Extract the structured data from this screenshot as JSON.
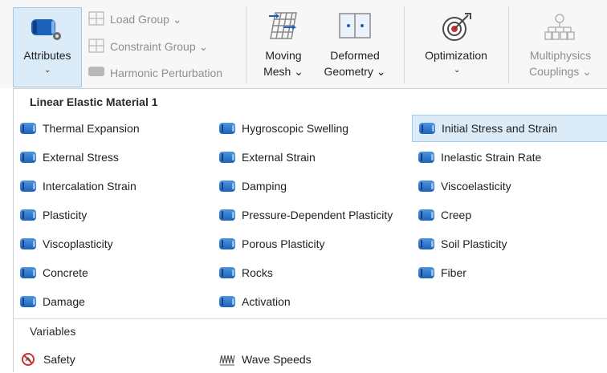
{
  "ribbon": {
    "attributes": {
      "label": "Attributes",
      "chevron": "⌄"
    },
    "load_group": "Load Group ⌄",
    "constraint_group": "Constraint Group ⌄",
    "harmonic_perturbation": "Harmonic Perturbation",
    "moving_mesh": {
      "line1": "Moving",
      "line2": "Mesh ⌄"
    },
    "deformed_geometry": {
      "line1": "Deformed",
      "line2": "Geometry ⌄"
    },
    "optimization": {
      "label": "Optimization",
      "chevron": "⌄"
    },
    "multiphysics": {
      "line1": "Multiphysics",
      "line2": "Couplings ⌄"
    }
  },
  "menu": {
    "section1_title": "Linear Elastic Material 1",
    "columns": [
      [
        "Thermal Expansion",
        "External Stress",
        "Intercalation Strain",
        "Plasticity",
        "Viscoplasticity",
        "Concrete",
        "Damage"
      ],
      [
        "Hygroscopic Swelling",
        "External Strain",
        "Damping",
        "Pressure-Dependent Plasticity",
        "Porous Plasticity",
        "Rocks",
        "Activation"
      ],
      [
        "Initial Stress and Strain",
        "Inelastic Strain Rate",
        "Viscoelasticity",
        "Creep",
        "Soil Plasticity",
        "Fiber"
      ]
    ],
    "selected_item": "Initial Stress and Strain",
    "section2_title": "Variables",
    "variables": [
      "Safety",
      "Wave Speeds"
    ]
  },
  "colors": {
    "accent_blue": "#1d62b8",
    "selection_bg": "#dcebf8",
    "safety_red": "#d0302f"
  }
}
